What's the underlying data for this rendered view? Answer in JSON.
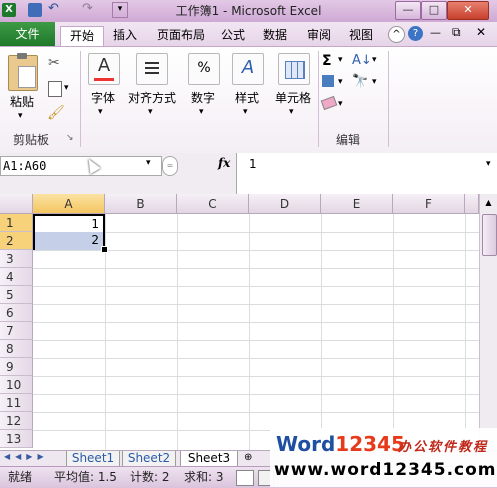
{
  "window": {
    "title": "工作簿1 - Microsoft Excel",
    "minimize": "—",
    "maximize": "□",
    "close": "✕"
  },
  "tabs": {
    "file": "文件",
    "items": [
      "开始",
      "插入",
      "页面布局",
      "公式",
      "数据",
      "审阅",
      "视图"
    ]
  },
  "ribbon": {
    "paste": "粘贴",
    "clipboard_group": "剪贴板",
    "font": "字体",
    "alignment": "对齐方式",
    "number": "数字",
    "styles": "样式",
    "cells": "单元格",
    "editing_group": "编辑",
    "font_icon": "A",
    "number_icon": "%",
    "sigma": "Σ"
  },
  "formula_bar": {
    "name_box": "A1:A60",
    "fx": "fx",
    "value": "1"
  },
  "grid": {
    "columns": [
      "A",
      "B",
      "C",
      "D",
      "E",
      "F"
    ],
    "rows": [
      "1",
      "2",
      "3",
      "4",
      "5",
      "6",
      "7",
      "8",
      "9",
      "10",
      "11",
      "12",
      "13"
    ],
    "cells": {
      "A1": "1",
      "A2": "2"
    }
  },
  "sheets": [
    "Sheet1",
    "Sheet2",
    "Sheet3"
  ],
  "status": {
    "ready": "就绪",
    "average": "平均值: 1.5",
    "count": "计数: 2",
    "sum": "求和: 3"
  },
  "watermark": {
    "brand_a": "Word",
    "brand_b": "12345",
    "tagline": "办公软件教程",
    "url": "www.word12345.com"
  }
}
